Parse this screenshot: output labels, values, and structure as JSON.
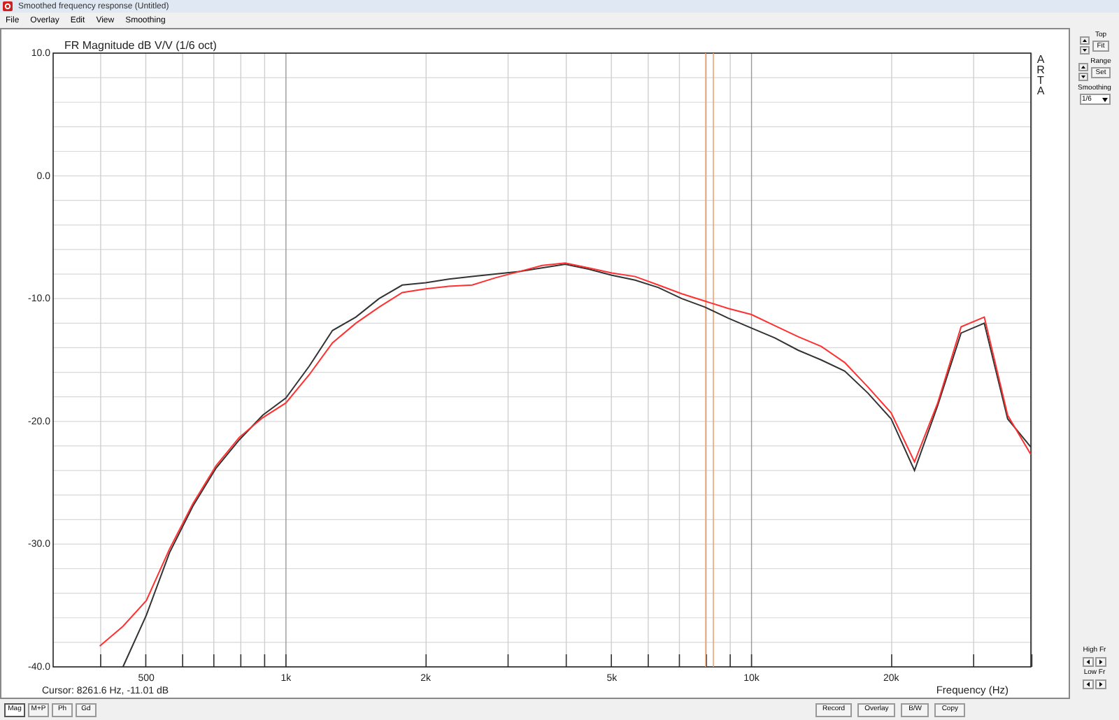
{
  "window": {
    "title": "Smoothed frequency response (Untitled)"
  },
  "menu": [
    "File",
    "Overlay",
    "Edit",
    "View",
    "Smoothing"
  ],
  "plot": {
    "brand": "ARTA",
    "cursor": "Cursor: 8261.6 Hz, -11.01 dB",
    "chart_data": {
      "type": "line",
      "title": "FR Magnitude dB V/V (1/6 oct)",
      "xlabel": "Frequency (Hz)",
      "categories": [
        null,
        null,
        "500",
        null,
        null,
        null,
        null,
        null,
        "1k",
        null,
        null,
        null,
        null,
        null,
        "2k",
        null,
        null,
        null,
        null,
        null,
        null,
        null,
        "5k",
        null,
        null,
        null,
        null,
        null,
        "10k",
        null,
        null,
        null,
        null,
        null,
        "20k",
        null,
        null,
        null,
        null,
        null,
        null
      ],
      "series": [
        {
          "color": "#333333",
          "values": [
            null,
            -40,
            -35.8,
            -30.7,
            -26.9,
            -23.8,
            -21.5,
            -19.5,
            -18.1,
            -15.5,
            -12.6,
            -11.5,
            -10.0,
            -8.9,
            -8.7,
            -8.4,
            -8.2,
            -8.0,
            -7.8,
            -7.5,
            -7.2,
            -7.6,
            -8.1,
            -8.5,
            -9.1,
            -10.0,
            -10.7,
            -11.6,
            -12.4,
            -13.2,
            -14.2,
            -15.0,
            -15.9,
            -17.7,
            -19.8,
            -24.0,
            -18.7,
            -12.8,
            -12.0,
            -19.8,
            -22.1
          ]
        },
        {
          "color": "#ff3030",
          "values": [
            -38.3,
            -36.7,
            -34.6,
            -30.4,
            -26.7,
            -23.6,
            -21.3,
            -19.7,
            -18.5,
            -16.2,
            -13.6,
            -12.0,
            -10.7,
            -9.5,
            -9.2,
            -9.0,
            -8.9,
            -8.3,
            -7.8,
            -7.3,
            -7.1,
            -7.5,
            -7.9,
            -8.2,
            -8.9,
            -9.6,
            -10.2,
            -10.8,
            -11.3,
            -12.2,
            -13.1,
            -13.9,
            -15.2,
            -17.2,
            -19.3,
            -23.3,
            -18.5,
            -12.3,
            -11.5,
            -19.5,
            -22.7
          ]
        }
      ],
      "ylim": [
        -40,
        10
      ],
      "grid": true,
      "yticks": [
        {
          "value": 10,
          "label": "10.0"
        },
        {
          "value": 0,
          "label": "0.0"
        },
        {
          "value": -10,
          "label": "-10.0"
        },
        {
          "value": -20,
          "label": "-20.0"
        },
        {
          "value": -30,
          "label": "-30.0"
        },
        {
          "value": -40,
          "label": "-40.0"
        }
      ]
    }
  },
  "view_buttons": [
    {
      "label": "Mag",
      "selected": true
    },
    {
      "label": "M+P",
      "selected": false
    },
    {
      "label": "Ph",
      "selected": false
    },
    {
      "label": "Gd",
      "selected": false
    }
  ],
  "action_buttons": [
    "Record",
    "Overlay",
    "B/W",
    "Copy"
  ],
  "side": {
    "top_label": "Top",
    "fit": "Fit",
    "range_label": "Range",
    "set": "Set",
    "smoothing_label": "Smoothing",
    "smoothing": "1/6",
    "high_label": "High Fr",
    "low_label": "Low Fr"
  }
}
